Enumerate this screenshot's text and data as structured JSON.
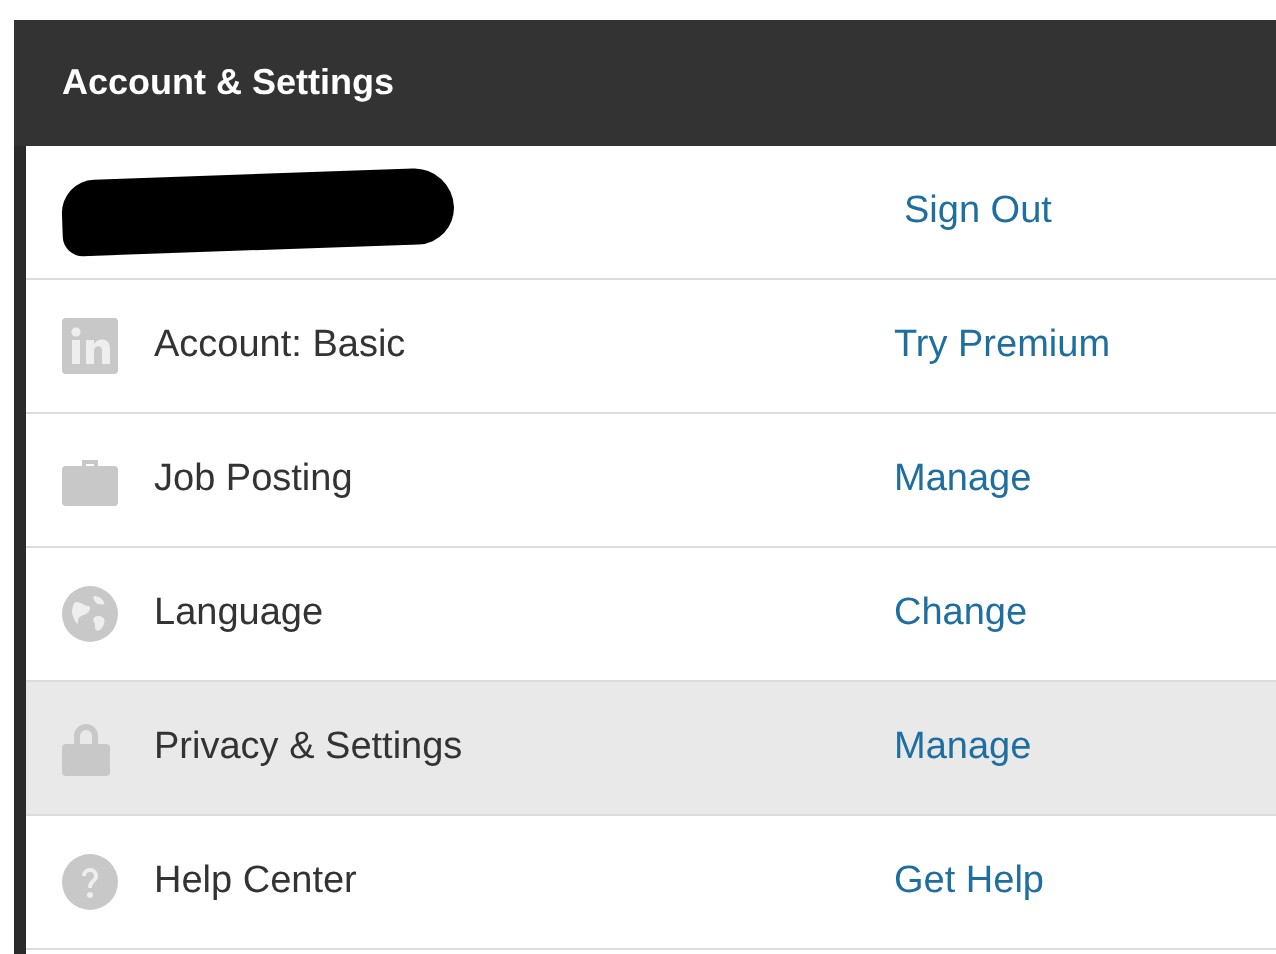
{
  "panel": {
    "title": "Account & Settings"
  },
  "rows": [
    {
      "kind": "account",
      "action": "Sign Out",
      "selected": false
    },
    {
      "kind": "item",
      "label": "Account: Basic",
      "action": "Try Premium",
      "selected": false
    },
    {
      "kind": "item",
      "label": "Job Posting",
      "action": "Manage",
      "selected": false
    },
    {
      "kind": "item",
      "label": "Language",
      "action": "Change",
      "selected": false
    },
    {
      "kind": "item",
      "label": "Privacy & Settings",
      "action": "Manage",
      "selected": true
    },
    {
      "kind": "item",
      "label": "Help Center",
      "action": "Get Help",
      "selected": false
    }
  ]
}
